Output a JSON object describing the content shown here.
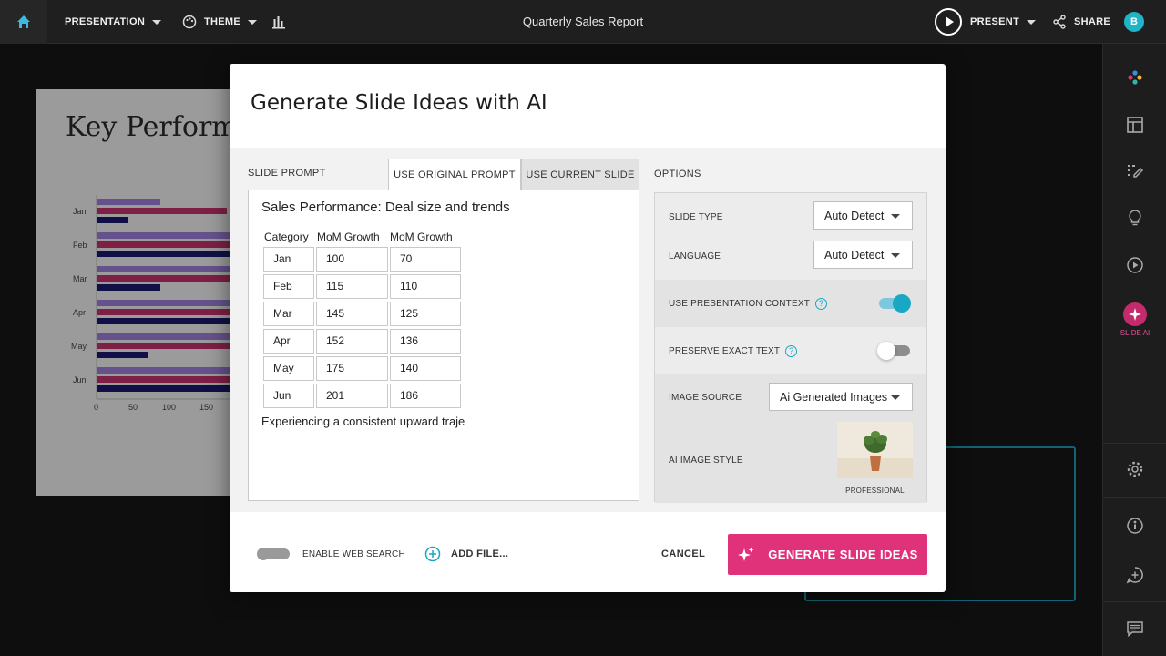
{
  "topbar": {
    "presentation_label": "PRESENTATION",
    "theme_label": "THEME",
    "title": "Quarterly Sales Report",
    "present_label": "PRESENT",
    "share_label": "SHARE",
    "avatar_initial": "B"
  },
  "sidebar": {
    "slide_ai_label": "SLIDE AI"
  },
  "background_slide": {
    "title": "Key Perform",
    "y_labels": [
      "Jan",
      "Feb",
      "Mar",
      "Apr",
      "May",
      "Jun"
    ],
    "x_ticks": [
      "0",
      "50",
      "100",
      "150"
    ]
  },
  "modal": {
    "title": "Generate Slide Ideas with AI",
    "slide_prompt_label": "SLIDE PROMPT",
    "tab_original": "USE ORIGINAL PROMPT",
    "tab_current": "USE CURRENT SLIDE",
    "prompt": {
      "heading": "Sales Performance: Deal size and trends",
      "columns": [
        "Category",
        "MoM Growth",
        "MoM Growth"
      ],
      "rows": [
        [
          "Jan",
          "100",
          "70"
        ],
        [
          "Feb",
          "115",
          "110"
        ],
        [
          "Mar",
          "145",
          "125"
        ],
        [
          "Apr",
          "152",
          "136"
        ],
        [
          "May",
          "175",
          "140"
        ],
        [
          "Jun",
          "201",
          "186"
        ]
      ],
      "footer_text": "Experiencing a consistent upward traje"
    },
    "options": {
      "label": "OPTIONS",
      "slide_type_label": "SLIDE TYPE",
      "slide_type_value": "Auto Detect",
      "language_label": "LANGUAGE",
      "language_value": "Auto Detect",
      "use_context_label": "USE PRESENTATION CONTEXT",
      "use_context_on": true,
      "preserve_text_label": "PRESERVE EXACT TEXT",
      "preserve_text_on": false,
      "image_source_label": "IMAGE SOURCE",
      "image_source_value": "Ai Generated Images",
      "ai_image_style_label": "AI IMAGE STYLE",
      "ai_image_style_value": "PROFESSIONAL"
    },
    "footer": {
      "web_search_label": "ENABLE WEB SEARCH",
      "web_search_on": false,
      "add_file_label": "ADD FILE...",
      "cancel_label": "CANCEL",
      "generate_label": "GENERATE SLIDE IDEAS"
    }
  },
  "colors": {
    "accent_cyan": "#1aa7c4",
    "primary_pink": "#e0327b"
  }
}
